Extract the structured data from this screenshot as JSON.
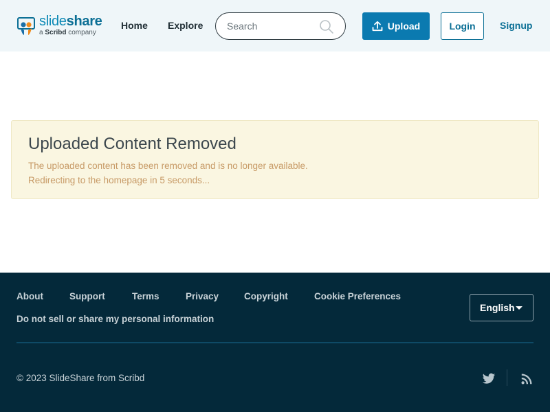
{
  "header": {
    "logo": {
      "word_light": "slide",
      "word_bold": "share",
      "sub_prefix": "a ",
      "sub_brand": "Scribd",
      "sub_suffix": " company"
    },
    "nav": {
      "home": "Home",
      "explore": "Explore"
    },
    "search": {
      "placeholder": "Search",
      "icon": "search-icon"
    },
    "upload_label": "Upload",
    "login_label": "Login",
    "signup_label": "Signup"
  },
  "alert": {
    "title": "Uploaded Content Removed",
    "message": "The uploaded content has been removed and is no longer available.",
    "redirect": "Redirecting to the homepage in 5 seconds..."
  },
  "footer": {
    "links": {
      "about": "About",
      "support": "Support",
      "terms": "Terms",
      "privacy": "Privacy",
      "copyright": "Copyright",
      "cookie": "Cookie Preferences",
      "do_not_sell": "Do not sell or share my personal information"
    },
    "language": "English",
    "copyright_text": "© 2023 SlideShare from Scribd",
    "social_icons": [
      "twitter-icon",
      "rss-icon"
    ]
  },
  "colors": {
    "accent": "#0b7ab0",
    "header_bg": "#eff6f9",
    "alert_bg": "#faf6e1",
    "alert_text": "#c79a66",
    "footer_bg": "#04293a"
  }
}
